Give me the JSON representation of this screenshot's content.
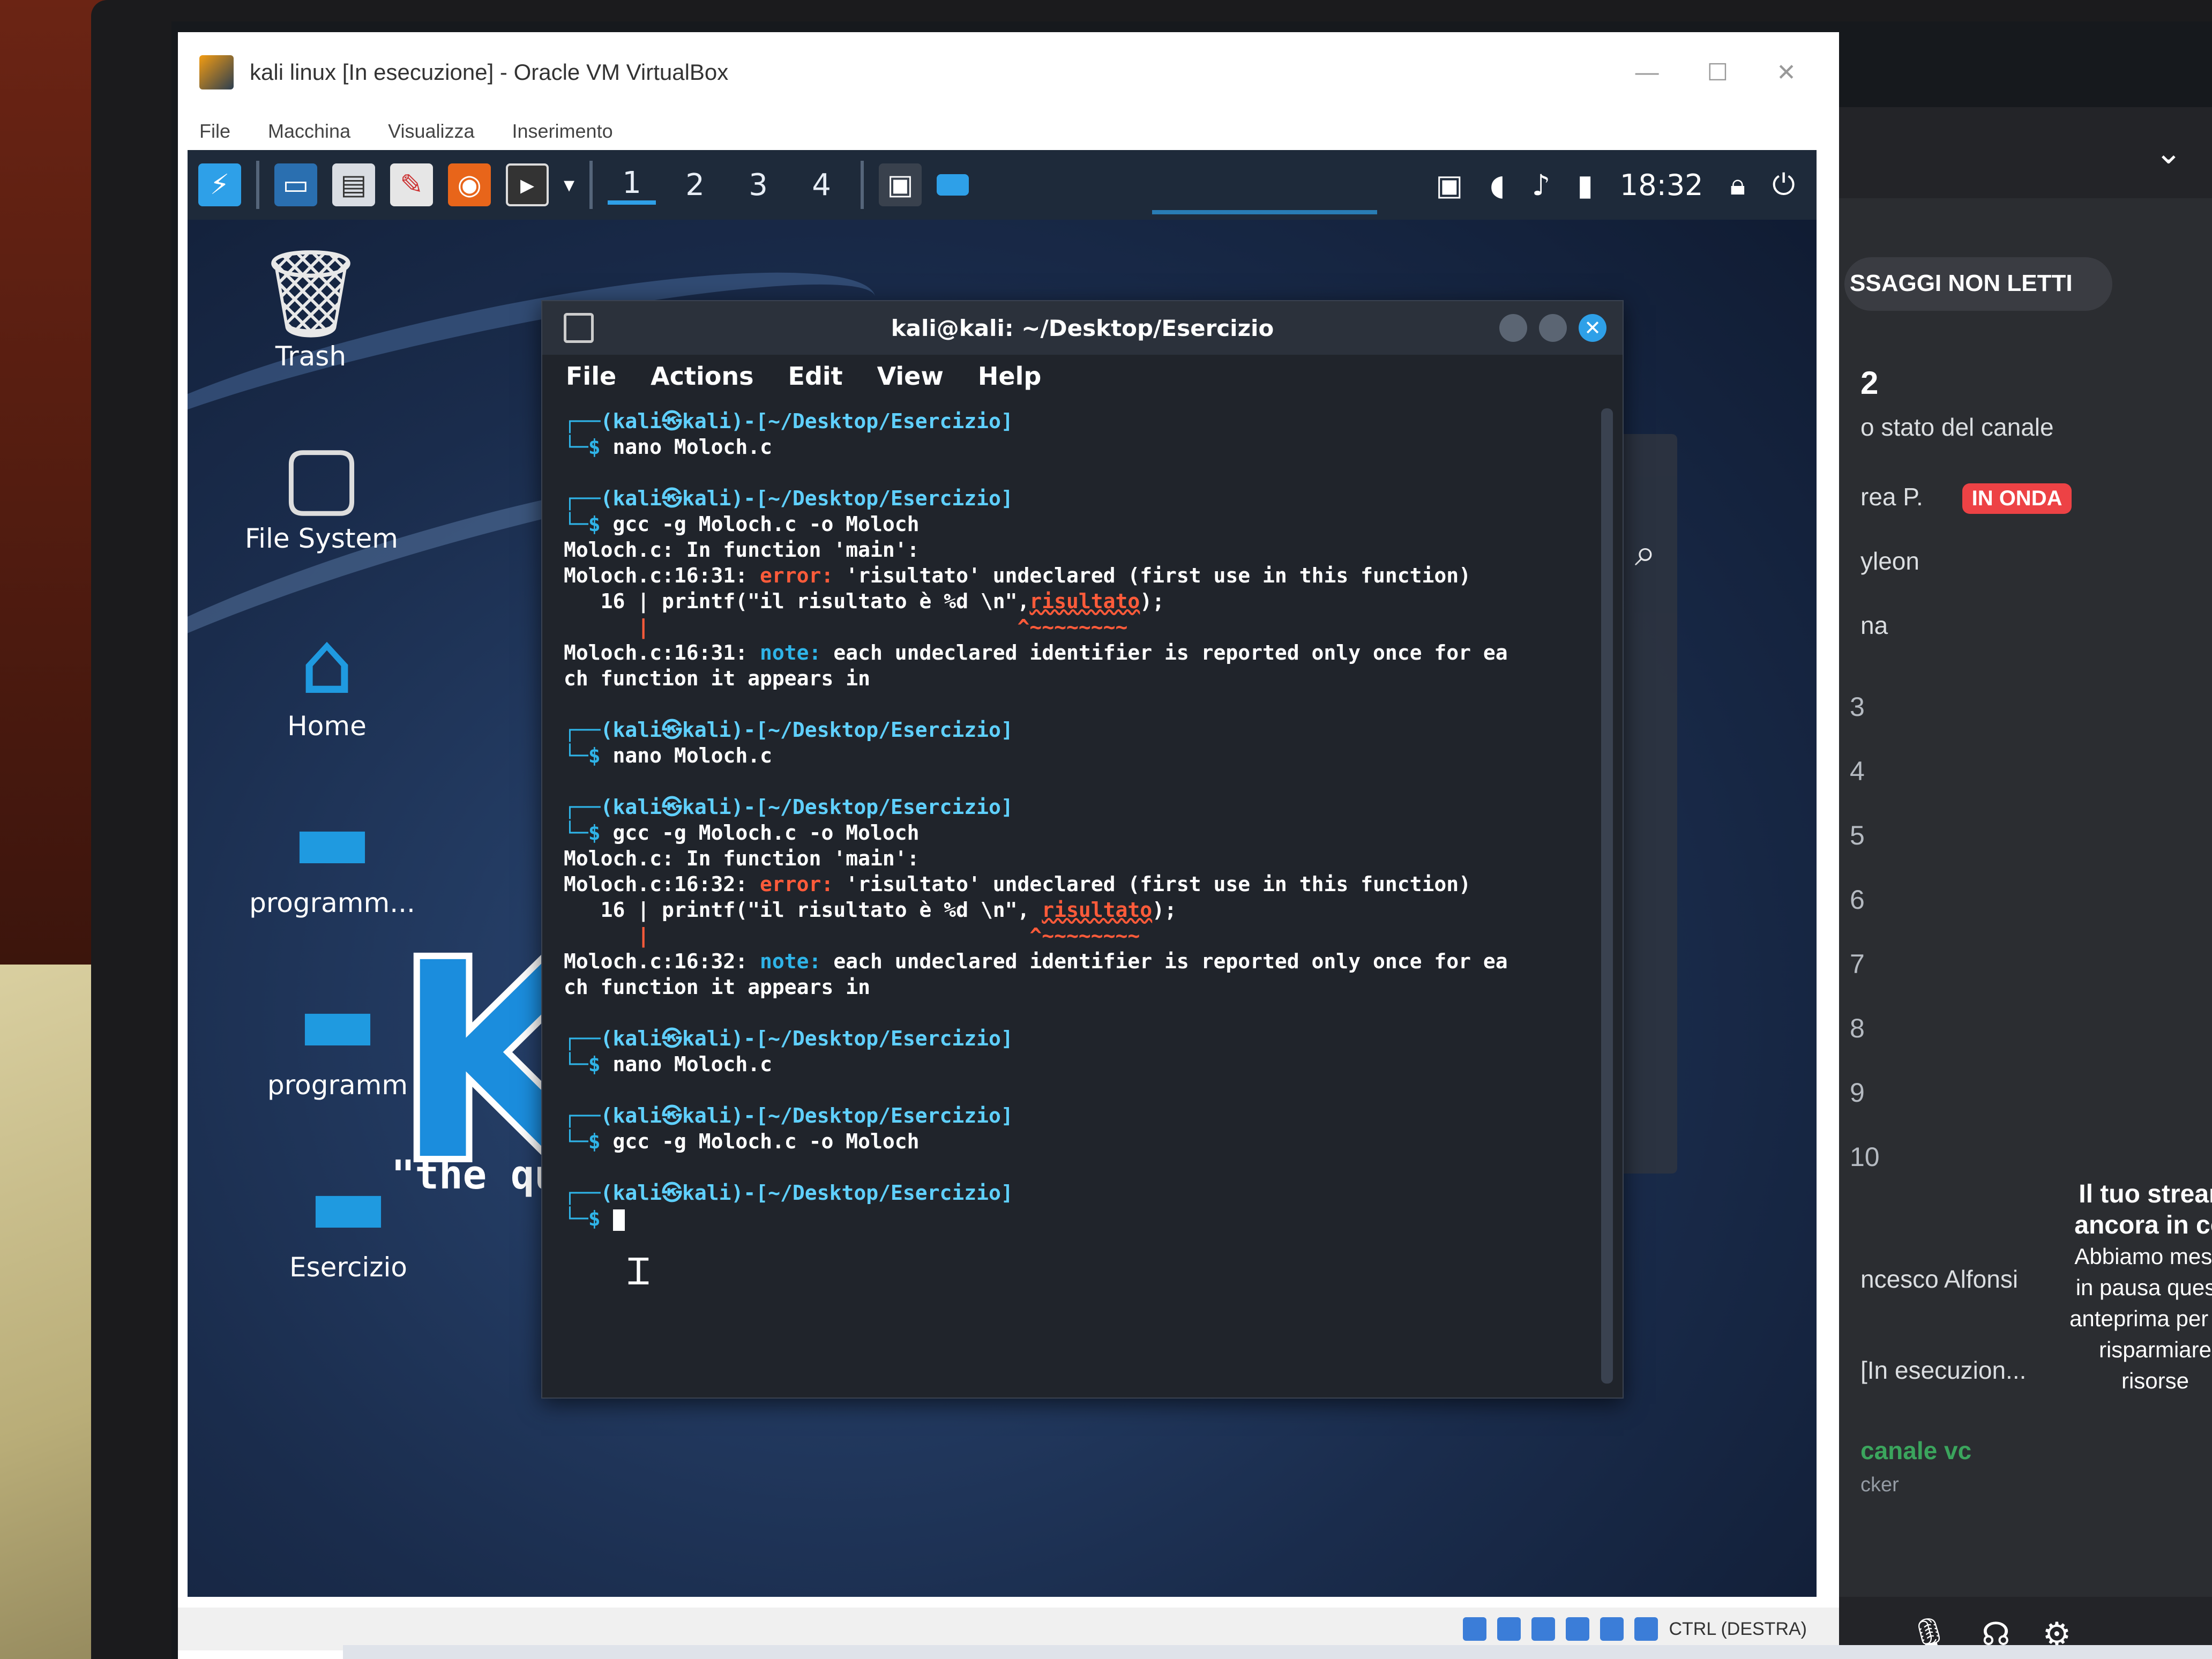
{
  "host_window": {
    "title": "kali linux [In esecuzione] - Oracle VM VirtualBox",
    "menu": [
      "File",
      "Macchina",
      "Visualizza",
      "Inserimento"
    ]
  },
  "panel": {
    "workspaces": [
      "1",
      "2",
      "3",
      "4"
    ],
    "clock": "18:32"
  },
  "desktop": {
    "icons": [
      {
        "label": "Trash",
        "icon": "trash-icon"
      },
      {
        "label": "File System",
        "icon": "drive-icon"
      },
      {
        "label": "Home",
        "icon": "home-folder-icon"
      },
      {
        "label": "programm...",
        "icon": "folder-icon"
      },
      {
        "label": "programm",
        "icon": "folder-icon"
      },
      {
        "label": "Esercizio",
        "icon": "folder-icon"
      }
    ],
    "wallpaper_logo": "KA",
    "wallpaper_quote": "\"the qui"
  },
  "terminal": {
    "title": "kali@kali: ~/Desktop/Esercizio",
    "menu": [
      "File",
      "Actions",
      "Edit",
      "View",
      "Help"
    ],
    "prompt_user": "(kali㉿kali)-[~/Desktop/Esercizio]",
    "prompt_symbol": "$",
    "lines": {
      "cmd1": "nano Moloch.c",
      "cmd2": "gcc -g Moloch.c -o Moloch",
      "in_function": "Moloch.c: In function 'main':",
      "err1_loc": "Moloch.c:16:31: ",
      "err_label": "error:",
      "err_msg": " 'risultato' undeclared (first use in this function)",
      "code_prefix1": "   16 | printf(\"il risultato è %d \\n\",",
      "code_var": "risultato",
      "code_suffix": ");",
      "caret1": "      |                              ^~~~~~~~~",
      "note1_loc": "Moloch.c:16:31: ",
      "note_label": "note:",
      "note_msg": " each undeclared identifier is reported only once for ea",
      "note_cont": "ch function it appears in",
      "cmd3": "nano Moloch.c",
      "cmd4": "gcc -g Moloch.c -o Moloch",
      "err2_loc": "Moloch.c:16:32: ",
      "code_prefix2": "   16 | printf(\"il risultato è %d \\n\", ",
      "caret2": "      |                               ^~~~~~~~~",
      "note2_loc": "Moloch.c:16:32: ",
      "cmd5": "nano Moloch.c",
      "cmd6": "gcc -g Moloch.c -o Moloch"
    }
  },
  "statusbar": {
    "host_key": "CTRL (DESTRA)"
  },
  "discord": {
    "unread_label": "SSAGGI NON LETTI",
    "server_count": "2",
    "channel_status": "o stato del canale",
    "live_user": "rea P.",
    "live_badge": "IN ONDA",
    "user2": "yleon",
    "user3": "na",
    "numbers": [
      "3",
      "4",
      "5",
      "6",
      "7",
      "8",
      "9",
      "10"
    ],
    "notice_title": "Il tuo stream",
    "notice_title2": "ancora in cor",
    "notice_body": "Abbiamo messo in pausa questa anteprima per far risparmiare risorse",
    "notice_badge": "IN O",
    "voice_user": "ncesco Alfonsi",
    "stream_item": "[In esecuzion...",
    "voice_channel": "canale vc",
    "voice_sub": "cker"
  }
}
